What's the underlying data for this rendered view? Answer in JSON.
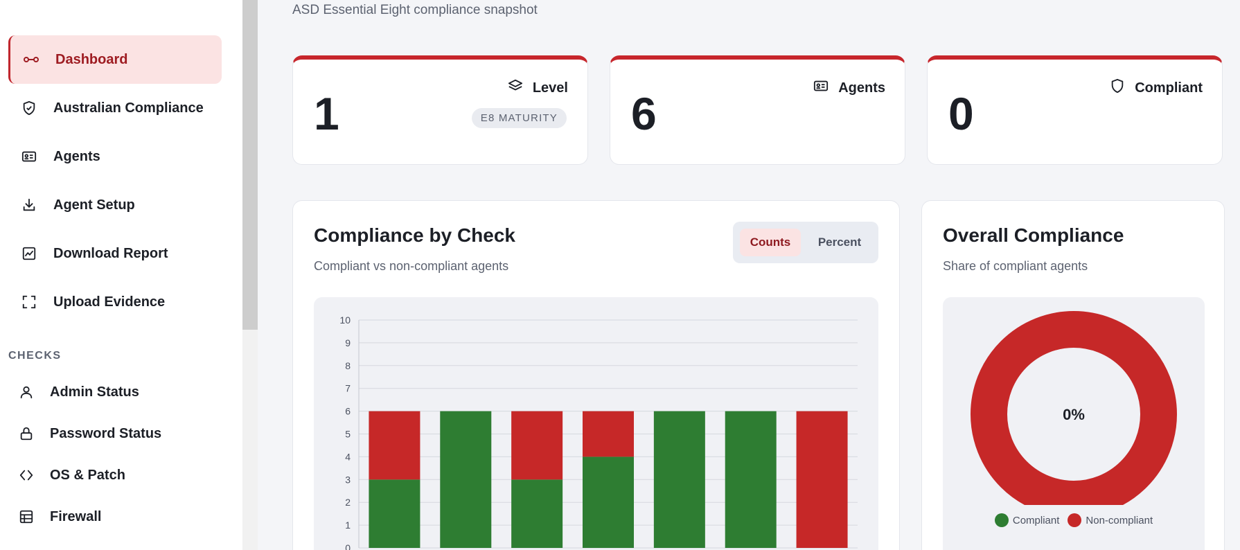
{
  "header": {
    "subtitle": "ASD Essential Eight compliance snapshot"
  },
  "sidebar": {
    "items": [
      {
        "label": "Dashboard",
        "icon": "link-icon",
        "active": true
      },
      {
        "label": "Australian Compliance",
        "icon": "shield-check-icon"
      },
      {
        "label": "Agents",
        "icon": "id-card-icon"
      },
      {
        "label": "Agent Setup",
        "icon": "download-icon"
      },
      {
        "label": "Download Report",
        "icon": "chart-line-icon"
      },
      {
        "label": "Upload Evidence",
        "icon": "scan-frame-icon"
      }
    ],
    "section_label": "CHECKS",
    "checks": [
      {
        "label": "Admin Status",
        "icon": "user-icon"
      },
      {
        "label": "Password Status",
        "icon": "lock-icon"
      },
      {
        "label": "OS & Patch",
        "icon": "code-icon"
      },
      {
        "label": "Firewall",
        "icon": "grid-icon"
      }
    ]
  },
  "stats": [
    {
      "value": "1",
      "label": "Level",
      "icon": "layers-icon",
      "badge": "E8 MATURITY"
    },
    {
      "value": "6",
      "label": "Agents",
      "icon": "id-card-icon"
    },
    {
      "value": "0",
      "label": "Compliant",
      "icon": "shield-icon"
    }
  ],
  "compliance_by_check": {
    "title": "Compliance by Check",
    "subtitle": "Compliant vs non-compliant agents",
    "toggle": {
      "counts": "Counts",
      "percent": "Percent",
      "selected": "Counts"
    }
  },
  "overall": {
    "title": "Overall Compliance",
    "subtitle": "Share of compliant agents",
    "center_label": "0%",
    "legend": [
      "Compliant",
      "Non-compliant"
    ]
  },
  "colors": {
    "accent": "#c7262c",
    "compliant": "#2e7d32",
    "non_compliant": "#c62828"
  },
  "chart_data": [
    {
      "type": "bar",
      "stacked": true,
      "ylim": [
        0,
        10
      ],
      "yticks": [
        0,
        1,
        2,
        3,
        4,
        5,
        6,
        7,
        8,
        9,
        10
      ],
      "series": [
        {
          "name": "Compliant",
          "values": [
            3,
            6,
            3,
            4,
            6,
            6,
            0
          ]
        },
        {
          "name": "Non-compliant",
          "values": [
            3,
            0,
            3,
            2,
            0,
            0,
            6
          ]
        }
      ],
      "grid": true
    },
    {
      "type": "pie",
      "donut": true,
      "categories": [
        "Compliant",
        "Non-compliant"
      ],
      "values": [
        0,
        6
      ],
      "legend_placement": "bottom"
    }
  ]
}
